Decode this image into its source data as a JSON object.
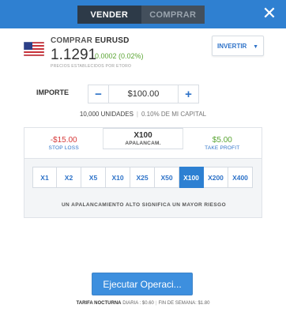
{
  "header": {
    "sell_label": "VENDER",
    "buy_label": "COMPRAR",
    "close_icon": "close-icon",
    "color": "#2f80d1"
  },
  "instrument": {
    "action": "COMPRAR",
    "symbol": "EURUSD",
    "price": "1.1291",
    "change": "0.0002 (0.02%)",
    "note": "PRECIOS ESTABLECIDOS POR ETORO",
    "flag_icon": "us-flag-icon",
    "invert_label": "INVERTIR"
  },
  "amount": {
    "label": "IMPORTE",
    "value": "$100.00",
    "units": "10,000 UNIDADES",
    "capital": "0.10% DE MI CAPITAL"
  },
  "tabs": {
    "stop_loss_value": "-$15.00",
    "stop_loss_label": "STOP LOSS",
    "leverage_value": "X100",
    "leverage_label": "APALANCAM.",
    "take_profit_value": "$5.00",
    "take_profit_label": "TAKE PROFIT"
  },
  "leverage": {
    "options": [
      "X1",
      "X2",
      "X5",
      "X10",
      "X25",
      "X50",
      "X100",
      "X200",
      "X400"
    ],
    "selected": "X100",
    "warning": "UN APALANCAMIENTO ALTO SIGNIFICA UN MAYOR RIESGO"
  },
  "footer": {
    "execute_label": "Ejecutar Operaci...",
    "fee_title": "TARIFA NOCTURNA",
    "fee_daily": "DIARIA : $0.60",
    "fee_weekend": "FIN DE SEMANA: $1.80"
  }
}
